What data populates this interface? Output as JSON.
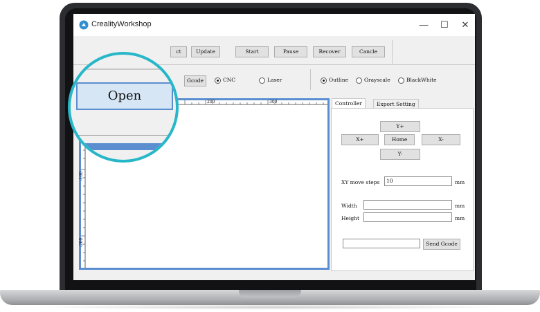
{
  "window": {
    "title": "CrealityWorkshop",
    "minimize": "—",
    "maximize": "☐",
    "close": "✕"
  },
  "toolbar": {
    "select_partial": "ct",
    "update": "Update",
    "start": "Start",
    "pause": "Pause",
    "recover": "Recover",
    "cancel": "Cancle"
  },
  "mode_bar": {
    "gcode_partial": "Gcode",
    "cnc": "CNC",
    "laser": "Laser",
    "selected_mode": "CNC",
    "outline": "Outline",
    "grayscale": "Grayscale",
    "blackwhite": "BlackWhite",
    "selected_render": "Outline"
  },
  "zoom": {
    "open_button": "Open"
  },
  "ruler": {
    "top_labels": [
      "200",
      "300"
    ],
    "left_labels": [
      "-100",
      "-200"
    ]
  },
  "panel": {
    "tabs": [
      {
        "label": "Controller",
        "active": true
      },
      {
        "label": "Export Setting",
        "active": false
      }
    ],
    "jog": {
      "y_plus": "Y+",
      "x_plus": "X+",
      "home": "Home",
      "x_minus": "X-",
      "y_minus": "Y-"
    },
    "xy_steps_label": "XY move steps",
    "xy_steps_value": "10",
    "unit": "mm",
    "width_label": "Width",
    "width_value": "",
    "height_label": "Height",
    "height_value": "",
    "gcode_value": "",
    "send_gcode": "Send Gcode"
  },
  "colors": {
    "accent_circle": "#27b7c9",
    "canvas_border": "#5b8ed0",
    "open_button_bg": "#d6e6f5"
  }
}
